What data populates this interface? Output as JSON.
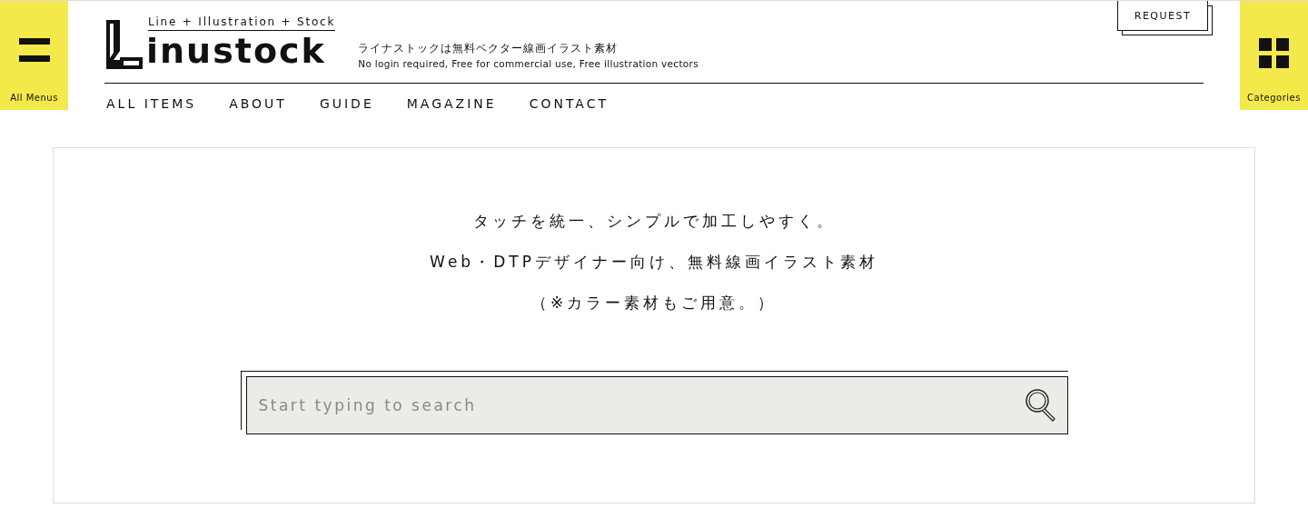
{
  "left_menu": {
    "label": "All Menus"
  },
  "logo": {
    "tagline": "Line + Illustration + Stock",
    "wordmark": "inustock"
  },
  "description": {
    "ja": "ライナストックは無料ベクター線画イラスト素材",
    "en": "No login required, Free for commercial use, Free illustration vectors"
  },
  "request_button": "REQUEST",
  "nav": [
    "ALL ITEMS",
    "ABOUT",
    "GUIDE",
    "MAGAZINE",
    "CONTACT"
  ],
  "right_menu": {
    "label": "Categories"
  },
  "hero": {
    "lines": [
      "タッチを統一、シンプルで加工しやすく。",
      "Web・DTPデザイナー向け、無料線画イラスト素材",
      "（※カラー素材もご用意。）"
    ]
  },
  "search": {
    "placeholder": "Start typing to search"
  }
}
